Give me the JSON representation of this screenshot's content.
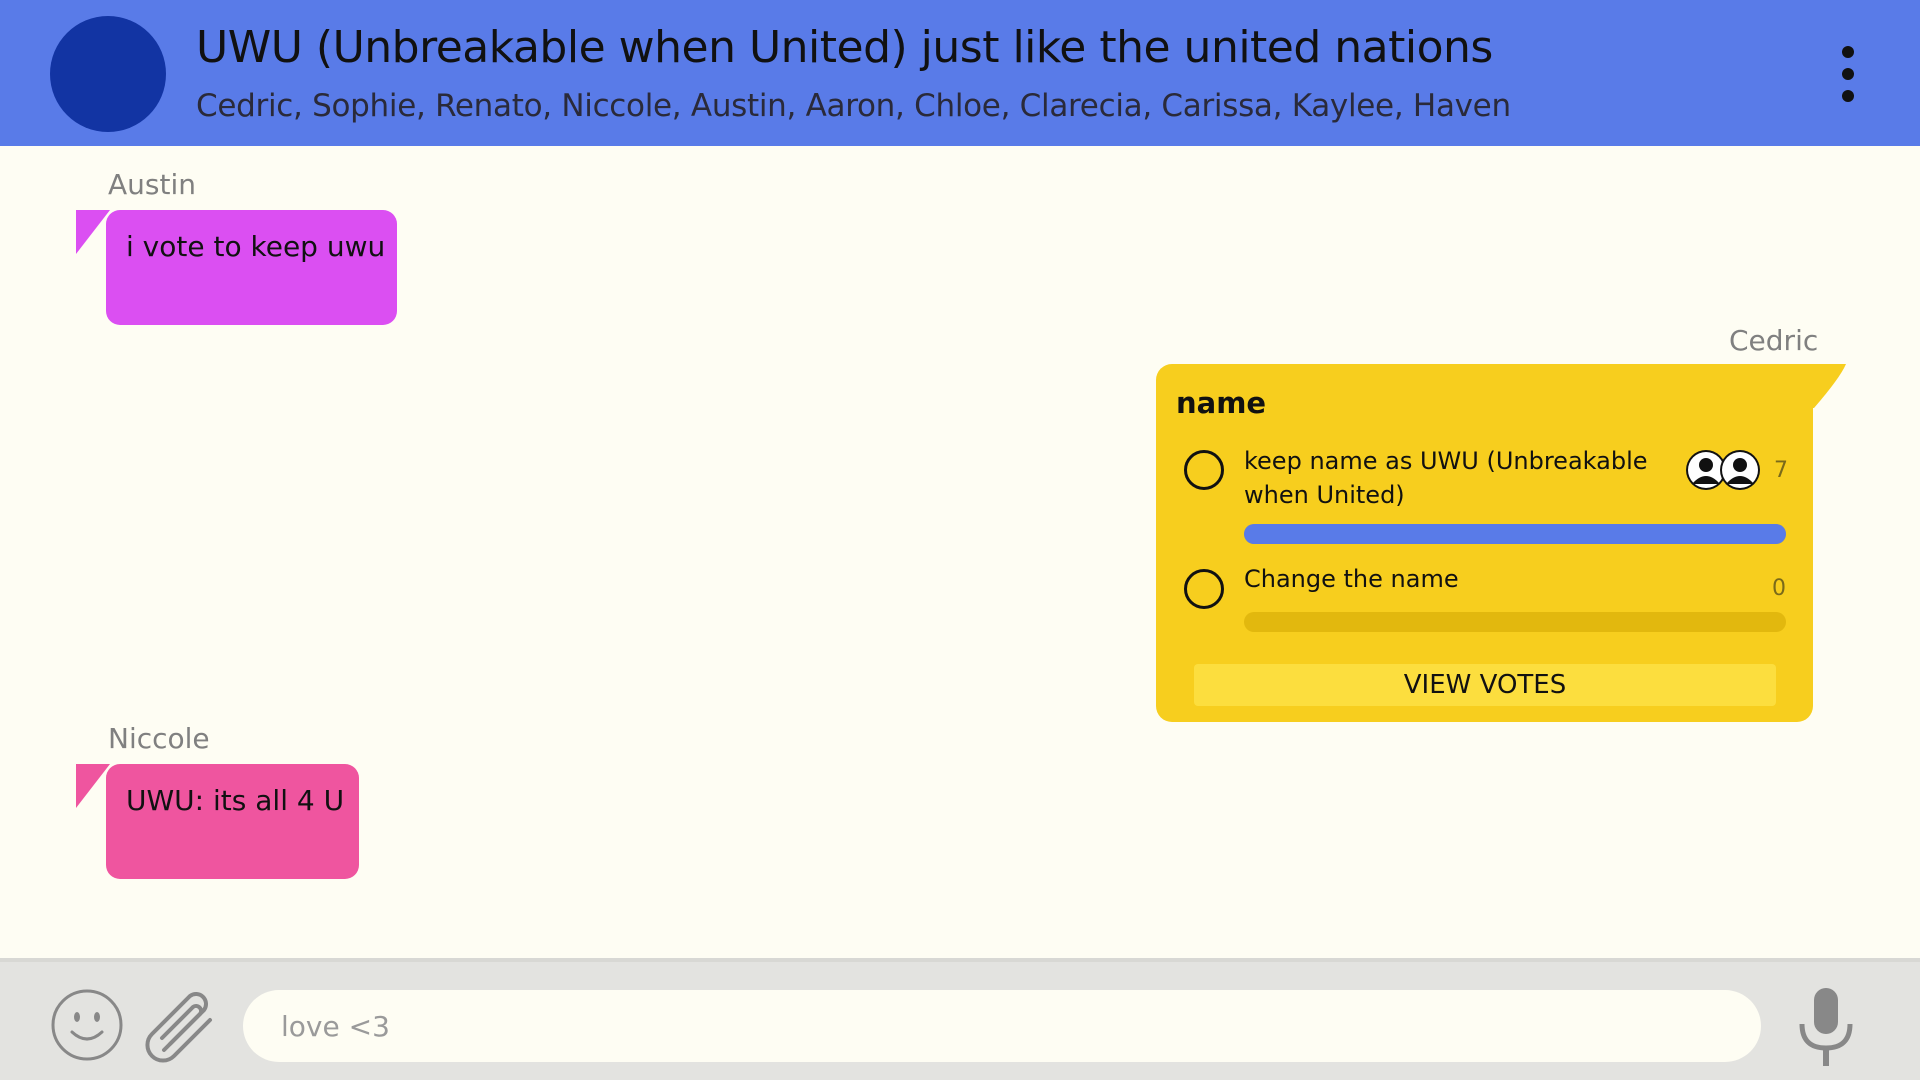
{
  "header": {
    "title": "UWU (Unbreakable when United) just like the united nations",
    "members": "Cedric, Sophie, Renato, Niccole, Austin, Aaron, Chloe, Clarecia, Carissa, Kaylee, Haven"
  },
  "messages": [
    {
      "sender": "Austin",
      "text": "i vote to keep uwu"
    },
    {
      "sender": "Niccole",
      "text": "UWU: its all 4 U"
    }
  ],
  "poll": {
    "sender": "Cedric",
    "title": "name",
    "options": [
      {
        "text": "keep name as UWU (Unbreakable when United)",
        "votes": "7",
        "fraction": 1.0
      },
      {
        "text": "Change the name",
        "votes": "0",
        "fraction": 0.0
      }
    ],
    "view_votes_label": "VIEW VOTES"
  },
  "composer": {
    "placeholder": "love <3"
  },
  "colors": {
    "header_bg": "#597BE8",
    "group_avatar": "#1234A3",
    "austin_bubble": "#DB4FF2",
    "niccole_bubble": "#EF559F",
    "poll_bg": "#F7CE1E",
    "poll_bar_fill": "#597BE8",
    "poll_bar_empty": "#E2B80E"
  },
  "icons": {
    "menu": "kebab-menu-icon",
    "emoji": "smiley-icon",
    "attach": "paperclip-icon",
    "mic": "microphone-icon",
    "voter": "user-avatar-icon"
  }
}
